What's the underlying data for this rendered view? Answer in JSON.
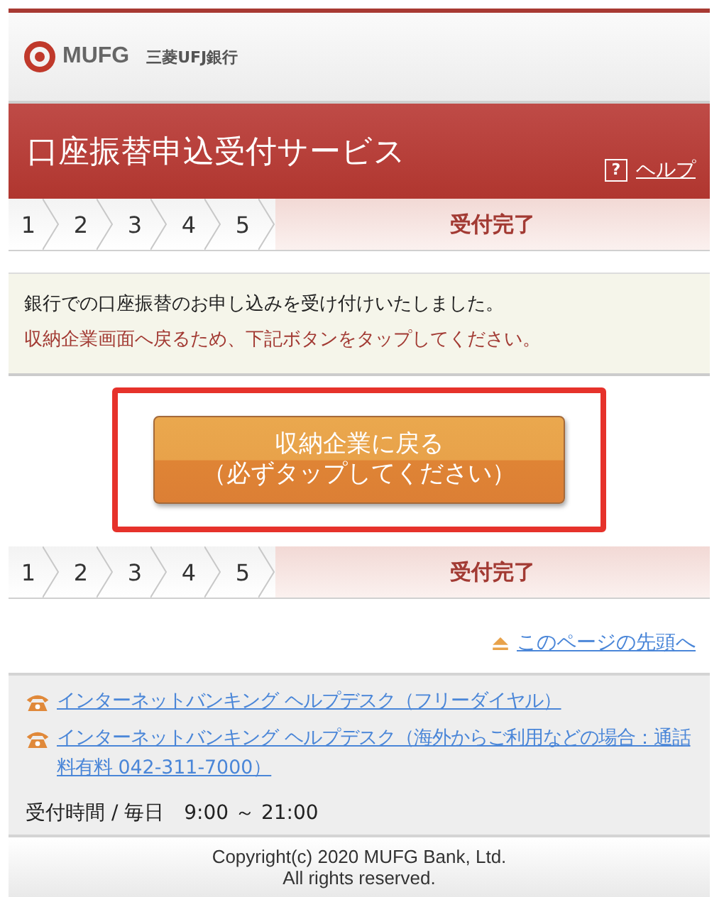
{
  "header": {
    "logo_text": "MUFG",
    "bank_name": "三菱UFJ銀行"
  },
  "title_bar": {
    "title": "口座振替申込受付サービス",
    "help_link": "ヘルプ",
    "help_icon": "?"
  },
  "steps_top": [
    {
      "label": "1",
      "selected": false
    },
    {
      "label": "2",
      "selected": false
    },
    {
      "label": "3",
      "selected": false
    },
    {
      "label": "4",
      "selected": false
    },
    {
      "label": "5",
      "selected": false
    },
    {
      "label": "受付完了",
      "selected": true
    }
  ],
  "notice": {
    "message": "銀行での口座振替のお申し込みを受け付けいたしました。",
    "instruction": "収納企業画面へ戻るため、下記ボタンをタップしてください。"
  },
  "return_button": {
    "lines": [
      "収納企業に戻る",
      "（必ずタップしてください）"
    ],
    "highlighted": true
  },
  "steps_bottom": [
    {
      "label": "1",
      "selected": false
    },
    {
      "label": "2",
      "selected": false
    },
    {
      "label": "3",
      "selected": false
    },
    {
      "label": "4",
      "selected": false
    },
    {
      "label": "5",
      "selected": false
    },
    {
      "label": "受付完了",
      "selected": true
    }
  ],
  "page_top_link": "このページの先頭へ",
  "help_desk": {
    "links": [
      "インターネットバンキング ヘルプデスク（フリーダイヤル）",
      "インターネットバンキング ヘルプデスク（海外からご利用などの場合：通話料有料 042-311-7000）"
    ],
    "hours": "受付時間 / 毎日　9:00 ～ 21:00"
  },
  "footer": {
    "copyright": [
      "Copyright(c) 2020 MUFG Bank, Ltd.",
      "All rights reserved."
    ]
  }
}
